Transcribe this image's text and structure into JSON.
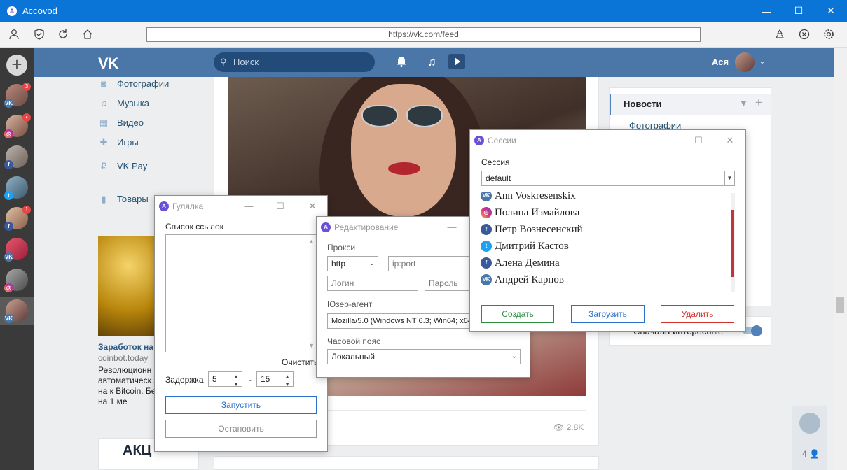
{
  "app": {
    "title": "Accovod",
    "logo_letter": "A"
  },
  "window_controls": {
    "minimize": "—",
    "maximize": "☐",
    "close": "✕"
  },
  "toolbar": {
    "url": "https://vk.com/feed",
    "icons": [
      "user-icon",
      "shield-icon",
      "refresh-icon",
      "home-icon",
      "recycle-icon",
      "close-circle-icon",
      "gear-icon"
    ]
  },
  "rail": {
    "add_label": "+",
    "accounts": [
      {
        "network": "vk",
        "network_label": "VK",
        "badge": "3"
      },
      {
        "network": "ig",
        "network_label": "◎",
        "badge": "•"
      },
      {
        "network": "fb",
        "network_label": "f",
        "badge": ""
      },
      {
        "network": "tw",
        "network_label": "t",
        "badge": ""
      },
      {
        "network": "fb",
        "network_label": "f",
        "badge": "1"
      },
      {
        "network": "vk",
        "network_label": "VK",
        "badge": ""
      },
      {
        "network": "ig",
        "network_label": "◎",
        "badge": ""
      },
      {
        "network": "vk",
        "network_label": "VK",
        "badge": ""
      }
    ]
  },
  "vk": {
    "logo": "VK",
    "search_placeholder": "Поиск",
    "user_name": "Ася",
    "menu": [
      {
        "icon": "camera-icon",
        "glyph": "◙",
        "label": "Фотографии"
      },
      {
        "icon": "music-icon",
        "glyph": "♫",
        "label": "Музыка"
      },
      {
        "icon": "video-icon",
        "glyph": "▦",
        "label": "Видео"
      },
      {
        "icon": "gamepad-icon",
        "glyph": "✚",
        "label": "Игры"
      },
      {
        "icon": "vkpay-icon",
        "glyph": "₽",
        "label": "VK Pay"
      },
      {
        "icon": "bag-icon",
        "glyph": "▮",
        "label": "Товары"
      }
    ],
    "ad": {
      "title": "Заработок на",
      "domain": "coinbot.today",
      "text": "Революционн автоматическ заработок на к Bitcoin. Беспла доступ на 1 ме",
      "ad2_label": "АКЦ"
    },
    "post": {
      "views": "2.8K"
    },
    "right_panel": {
      "news_label": "Новости",
      "photos_label": "Фотографии",
      "interesting_label": "Сначала интересные"
    },
    "chat_count": "4"
  },
  "dialogs": {
    "gulyalka": {
      "title": "Гулялка",
      "links_label": "Список ссылок",
      "clear_label": "Очистить",
      "delay_label": "Задержка",
      "delay_from": "5",
      "delay_dash": "-",
      "delay_to": "15",
      "start_label": "Запустить",
      "stop_label": "Остановить"
    },
    "edit": {
      "title": "Редактирование",
      "proxy_label": "Прокси",
      "proxy_type": "http",
      "proxy_addr_placeholder": "ip:port",
      "login_placeholder": "Логин",
      "password_placeholder": "Пароль",
      "ua_label": "Юзер-агент",
      "ua_value": "Mozilla/5.0 (Windows NT 6.3; Win64; x64)",
      "tz_label": "Часовой пояс",
      "tz_value": "Локальный"
    },
    "sessions": {
      "title": "Сессии",
      "session_label": "Сессия",
      "session_value": "default",
      "items": [
        {
          "network": "vk",
          "glyph": "VK",
          "name": "Ann Voskresenskix"
        },
        {
          "network": "ig",
          "glyph": "◎",
          "name": "Полина Измайлова"
        },
        {
          "network": "fb",
          "glyph": "f",
          "name": "Петр Вознесенский"
        },
        {
          "network": "tw",
          "glyph": "t",
          "name": "Дмитрий Кастов"
        },
        {
          "network": "fb",
          "glyph": "f",
          "name": "Алена Демина"
        },
        {
          "network": "vk",
          "glyph": "VK",
          "name": "Андрей Карпов"
        }
      ],
      "create_label": "Создать",
      "load_label": "Загрузить",
      "delete_label": "Удалить"
    }
  },
  "colors": {
    "titlebar": "#0a74d7",
    "vk_header": "#4a76a8",
    "create_green": "#2e8b3d",
    "load_blue": "#2a6fc9",
    "delete_red": "#d0312d",
    "start_blue": "#2a6fc9"
  }
}
